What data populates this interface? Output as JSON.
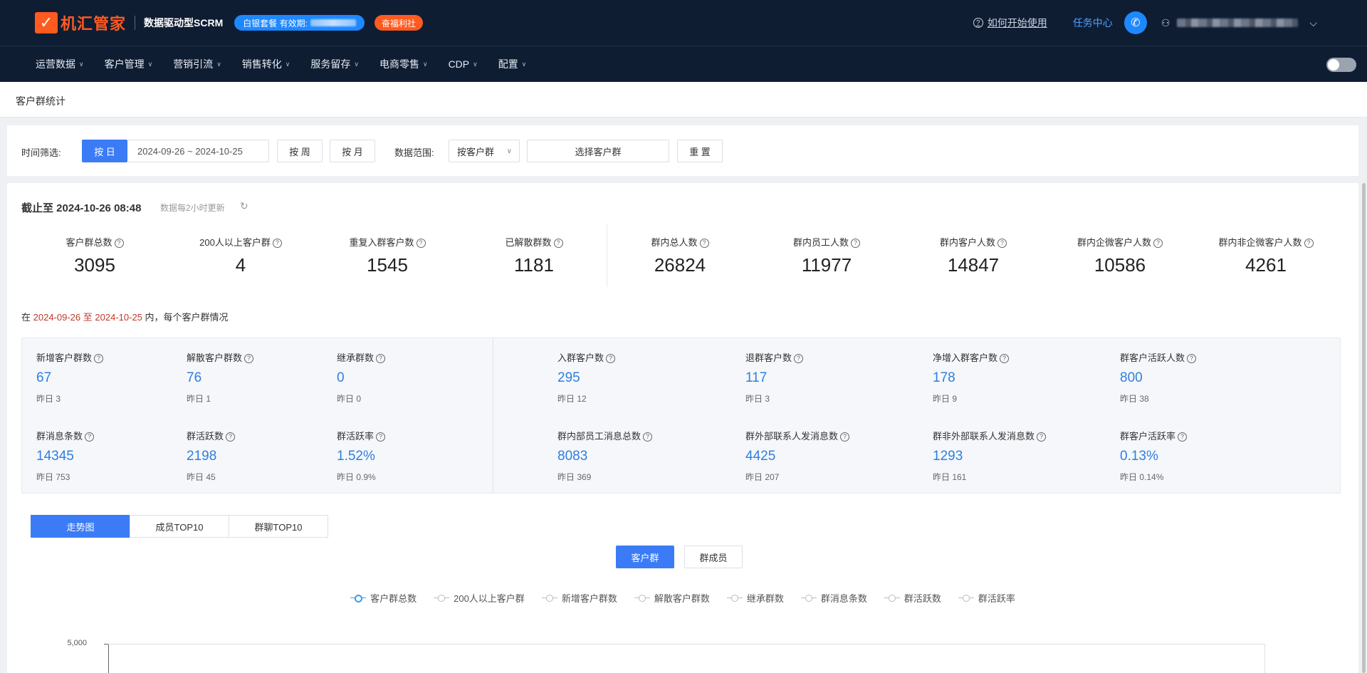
{
  "header": {
    "logo_mark": "✓",
    "logo_text": "机汇管家",
    "subtitle": "数据驱动型SCRM",
    "plan_badge": "白银套餐 有效期:",
    "benefit_badge": "奋福利社",
    "help_link": "如何开始使用",
    "task_center": "任务中心"
  },
  "nav": {
    "items": [
      "运营数据",
      "客户管理",
      "营销引流",
      "销售转化",
      "服务留存",
      "电商零售",
      "CDP",
      "配置"
    ]
  },
  "breadcrumb": "客户群统计",
  "filter": {
    "time_label": "时间筛选:",
    "by_day": "按 日",
    "date_range": "2024-09-26 ~ 2024-10-25",
    "by_week": "按 周",
    "by_month": "按 月",
    "scope_label": "数据范围:",
    "scope_select": "按客户群",
    "choose_group": "选择客户群",
    "reset": "重 置"
  },
  "summary": {
    "updated_at": "截止至 2024-10-26 08:48",
    "update_note": "数据每2小时更新",
    "stats": [
      {
        "label": "客户群总数",
        "value": "3095"
      },
      {
        "label": "200人以上客户群",
        "value": "4"
      },
      {
        "label": "重复入群客户数",
        "value": "1545"
      },
      {
        "label": "已解散群数",
        "value": "1181"
      },
      {
        "label": "群内总人数",
        "value": "26824"
      },
      {
        "label": "群内员工人数",
        "value": "11977"
      },
      {
        "label": "群内客户人数",
        "value": "14847"
      },
      {
        "label": "群内企微客户人数",
        "value": "10586"
      },
      {
        "label": "群内非企微客户人数",
        "value": "4261"
      }
    ]
  },
  "period": {
    "prefix": "在",
    "start": "2024-09-26",
    "to": "至",
    "end": "2024-10-25",
    "suffix": "内，每个客户群情况"
  },
  "metrics": [
    {
      "label": "新增客户群数",
      "value": "67",
      "prev": "昨日 3"
    },
    {
      "label": "解散客户群数",
      "value": "76",
      "prev": "昨日 1"
    },
    {
      "label": "继承群数",
      "value": "0",
      "prev": "昨日 0"
    },
    {
      "label": "入群客户数",
      "value": "295",
      "prev": "昨日 12"
    },
    {
      "label": "退群客户数",
      "value": "117",
      "prev": "昨日 3"
    },
    {
      "label": "净增入群客户数",
      "value": "178",
      "prev": "昨日 9"
    },
    {
      "label": "群客户活跃人数",
      "value": "800",
      "prev": "昨日 38"
    },
    {
      "label": "群消息条数",
      "value": "14345",
      "prev": "昨日 753"
    },
    {
      "label": "群活跃数",
      "value": "2198",
      "prev": "昨日 45"
    },
    {
      "label": "群活跃率",
      "value": "1.52%",
      "prev": "昨日 0.9%"
    },
    {
      "label": "群内部员工消息总数",
      "value": "8083",
      "prev": "昨日 369"
    },
    {
      "label": "群外部联系人发消息数",
      "value": "4425",
      "prev": "昨日 207"
    },
    {
      "label": "群非外部联系人发消息数",
      "value": "1293",
      "prev": "昨日 161"
    },
    {
      "label": "群客户活跃率",
      "value": "0.13%",
      "prev": "昨日 0.14%"
    }
  ],
  "tabs": [
    "走势图",
    "成员TOP10",
    "群聊TOP10"
  ],
  "subtoggle": [
    "客户群",
    "群成员"
  ],
  "legend": [
    "客户群总数",
    "200人以上客户群",
    "新增客户群数",
    "解散客户群数",
    "继承群数",
    "群消息条数",
    "群活跃数",
    "群活跃率"
  ],
  "chart": {
    "y_top_label": "5,000"
  },
  "colors": {
    "topbar": "#0f1d33",
    "accent": "#3b7cf6",
    "brand": "#ff5a1f",
    "metric_value": "#2e7ee0"
  }
}
